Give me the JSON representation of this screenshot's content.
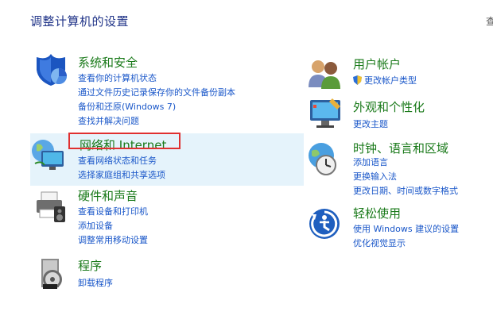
{
  "header": {
    "title": "调整计算机的设置",
    "view_by_cut": "查"
  },
  "left": [
    {
      "title": "系统和安全",
      "icon": "shield-pie-icon",
      "links": [
        "查看你的计算机状态",
        "通过文件历史记录保存你的文件备份副本",
        "备份和还原(Windows 7)",
        "查找并解决问题"
      ]
    },
    {
      "title": "网络和 Internet",
      "icon": "network-globe-monitor-icon",
      "highlighted": true,
      "links": [
        "查看网络状态和任务",
        "选择家庭组和共享选项"
      ]
    },
    {
      "title": "硬件和声音",
      "icon": "printer-speaker-icon",
      "links": [
        "查看设备和打印机",
        "添加设备",
        "调整常用移动设置"
      ]
    },
    {
      "title": "程序",
      "icon": "program-disc-icon",
      "links": [
        "卸载程序"
      ]
    }
  ],
  "right": [
    {
      "title": "用户帐户",
      "icon": "users-icon",
      "links": [
        "更改帐户类型"
      ],
      "first_link_icon": "uac-shield-icon"
    },
    {
      "title": "外观和个性化",
      "icon": "monitor-brush-icon",
      "links": [
        "更改主题"
      ]
    },
    {
      "title": "时钟、语言和区域",
      "icon": "clock-globe-icon",
      "links": [
        "添加语言",
        "更换输入法",
        "更改日期、时间或数字格式"
      ]
    },
    {
      "title": "轻松使用",
      "icon": "accessibility-icon",
      "links": [
        "使用 Windows 建议的设置",
        "优化视觉显示"
      ]
    }
  ],
  "colors": {
    "title": "#1a7a1a",
    "link": "#1a57c9",
    "highlight_bg": "#e5f3fb",
    "box": "#e03030"
  }
}
